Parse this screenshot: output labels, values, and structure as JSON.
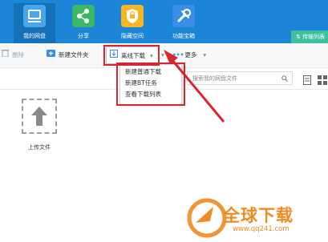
{
  "nav": {
    "items": [
      {
        "label": "我的网盘",
        "icon": "disk-icon",
        "active": true
      },
      {
        "label": "分享",
        "icon": "share-icon",
        "active": false
      },
      {
        "label": "隐藏空间",
        "icon": "lock-icon",
        "active": false
      },
      {
        "label": "功能宝箱",
        "icon": "toolbox-icon",
        "active": false
      }
    ],
    "transfer_label": "传输列表"
  },
  "toolbar": {
    "delete_label": "删除",
    "new_folder_label": "新建文件夹",
    "offline_download_label": "离线下载",
    "more_label": "更多"
  },
  "dropdown": {
    "items": [
      "新建普通下载",
      "新建BT任务",
      "查看下载列表"
    ]
  },
  "search": {
    "placeholder": "搜索我的网盘文件"
  },
  "content": {
    "upload_label": "上传文件"
  },
  "watermark": {
    "text": "全球下载",
    "url": "www.qq241.com"
  },
  "colors": {
    "topbar": "#1b86d8",
    "annotation_red": "#d8252f",
    "transfer_green": "#3cc0a0",
    "watermark_orange": "#f08a21"
  }
}
